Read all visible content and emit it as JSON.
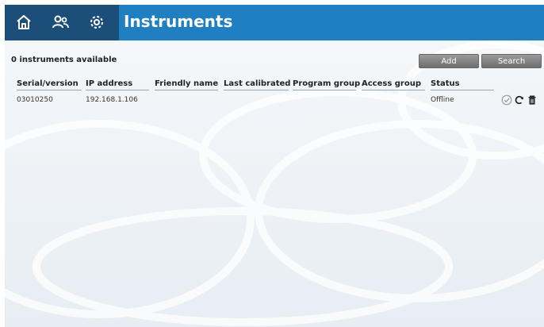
{
  "header": {
    "title": "Instruments",
    "icons": [
      "home-icon",
      "users-icon",
      "gear-icon"
    ]
  },
  "toolbar": {
    "count_text": "0 instruments available",
    "add_label": "Add",
    "search_label": "Search"
  },
  "table": {
    "columns": [
      "Serial/version",
      "IP address",
      "Friendly name",
      "Last calibrated",
      "Program group",
      "Access group",
      "Status"
    ],
    "rows": [
      {
        "serial": "03010250",
        "ip": "192.168.1.106",
        "friendly_name": "",
        "last_calibrated": "",
        "program_group": "",
        "access_group": "",
        "status": "Offline",
        "actions": [
          "check-circle-icon",
          "refresh-icon",
          "trash-icon"
        ]
      }
    ]
  },
  "colors": {
    "titlebar": "#1f7fc1",
    "iconblock": "#1b4f7a",
    "button": "#7f7f7f"
  }
}
